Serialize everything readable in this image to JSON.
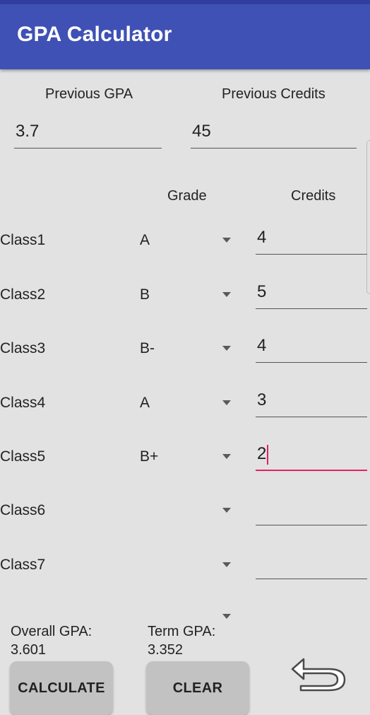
{
  "app": {
    "title": "GPA Calculator"
  },
  "previous": {
    "gpa_label": "Previous GPA",
    "gpa_value": "3.7",
    "credits_label": "Previous Credits",
    "credits_value": "45"
  },
  "headers": {
    "grade": "Grade",
    "credits": "Credits"
  },
  "classes": [
    {
      "label": "Class1",
      "grade": "A",
      "credits": "4"
    },
    {
      "label": "Class2",
      "grade": "B",
      "credits": "5"
    },
    {
      "label": "Class3",
      "grade": "B-",
      "credits": "4"
    },
    {
      "label": "Class4",
      "grade": "A",
      "credits": "3"
    },
    {
      "label": "Class5",
      "grade": "B+",
      "credits": "2"
    },
    {
      "label": "Class6",
      "grade": "",
      "credits": ""
    },
    {
      "label": "Class7",
      "grade": "",
      "credits": ""
    }
  ],
  "results": {
    "overall_label": "Overall GPA:",
    "overall_value": "3.601",
    "term_label": "Term GPA:",
    "term_value": "3.352"
  },
  "buttons": {
    "calculate": "CALCULATE",
    "clear": "CLEAR"
  },
  "icons": {
    "back": "undo-arrow-icon",
    "spinner": "dropdown-arrow-icon"
  },
  "colors": {
    "appbar": "#3f51b5",
    "accent": "#e91e63",
    "background": "#e2e2e2"
  }
}
